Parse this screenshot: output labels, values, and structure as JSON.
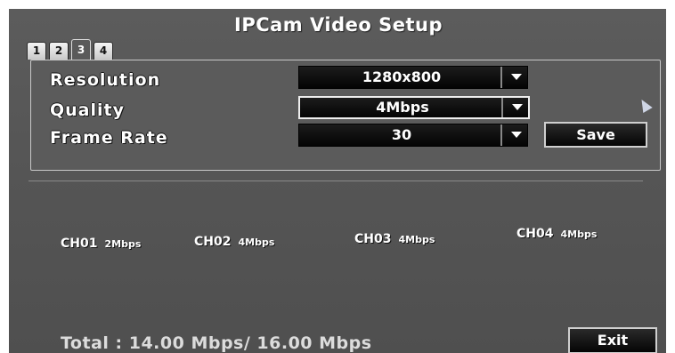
{
  "title": "IPCam Video Setup",
  "tabs": [
    "1",
    "2",
    "3",
    "4"
  ],
  "active_tab": "3",
  "settings": {
    "resolution": {
      "label": "Resolution",
      "value": "1280x800"
    },
    "quality": {
      "label": "Quality",
      "value": "4Mbps"
    },
    "frame_rate": {
      "label": "Frame Rate",
      "value": "30"
    }
  },
  "save_label": "Save",
  "channels": [
    {
      "name": "CH01",
      "rate": "2Mbps"
    },
    {
      "name": "CH02",
      "rate": "4Mbps"
    },
    {
      "name": "CH03",
      "rate": "4Mbps"
    },
    {
      "name": "CH04",
      "rate": "4Mbps"
    }
  ],
  "total": "Total : 14.00 Mbps/ 16.00 Mbps",
  "exit_label": "Exit",
  "colors": {
    "background": "#565656",
    "dropdown": "#0a0a0a",
    "text": "#ffffff"
  }
}
